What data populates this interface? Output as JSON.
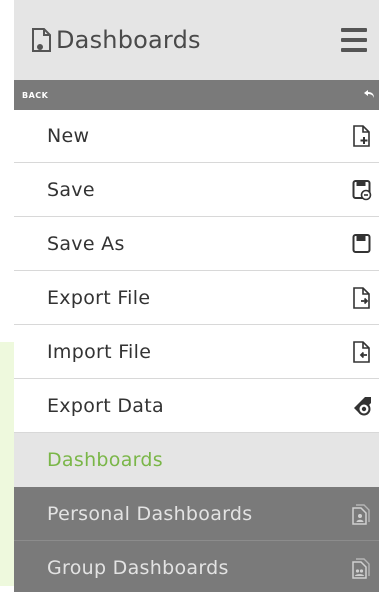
{
  "header": {
    "title": "Dashboards"
  },
  "back": {
    "label": "BACK"
  },
  "menu": [
    {
      "label": "New",
      "icon": "new-file-icon"
    },
    {
      "label": "Save",
      "icon": "save-icon"
    },
    {
      "label": "Save As",
      "icon": "save-as-icon"
    },
    {
      "label": "Export File",
      "icon": "export-file-icon"
    },
    {
      "label": "Import File",
      "icon": "import-file-icon"
    },
    {
      "label": "Export Data",
      "icon": "export-data-icon"
    }
  ],
  "section": {
    "label": "Dashboards"
  },
  "dashboards": [
    {
      "label": "Personal Dashboards",
      "icon": "personal-dashboards-icon"
    },
    {
      "label": "Group Dashboards",
      "icon": "group-dashboards-icon"
    }
  ],
  "colors": {
    "accent": "#7ab648",
    "header_bg": "#e5e5e5",
    "back_bar": "#7a7a7a",
    "dark_item": "#7a7a7a",
    "green_panel": "#eef9dd"
  }
}
